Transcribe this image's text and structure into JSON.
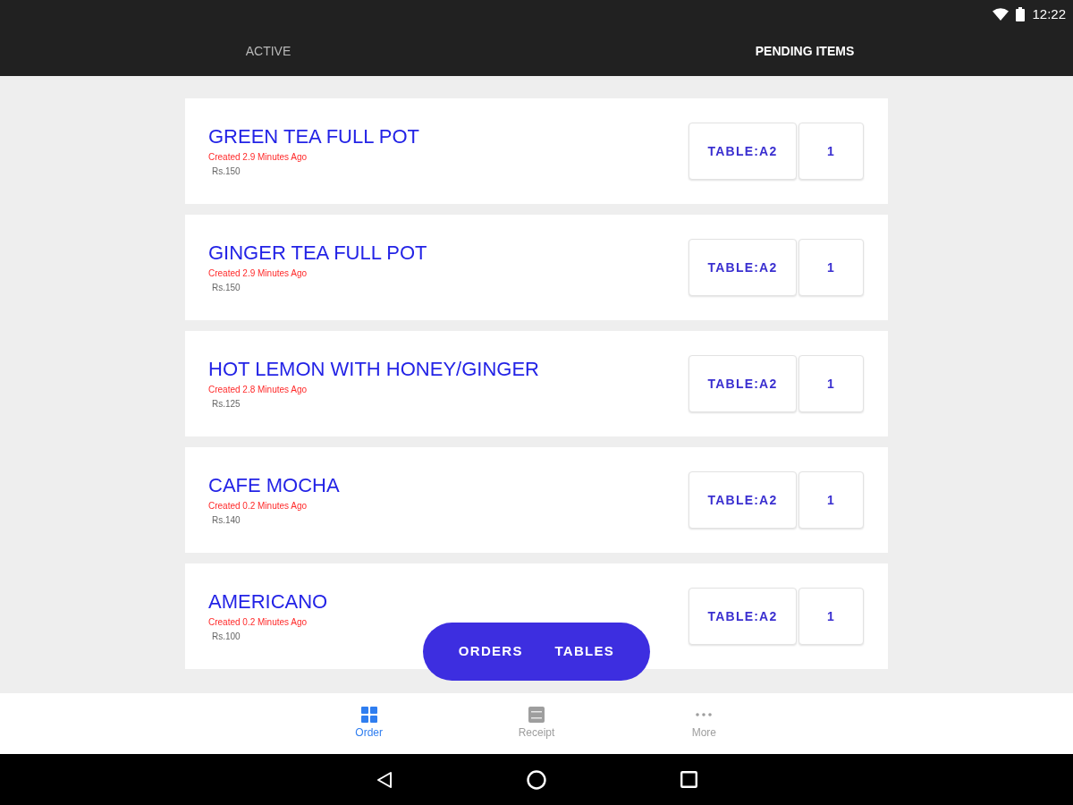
{
  "status_bar": {
    "time": "12:22"
  },
  "tabs": [
    {
      "label": "ACTIVE",
      "selected": false
    },
    {
      "label": "PENDING ITEMS",
      "selected": true
    }
  ],
  "orders": [
    {
      "name": "GREEN TEA FULL POT",
      "created": "Created 2.9 Minutes Ago",
      "price": "Rs.150",
      "table": "TABLE:A2",
      "quantity": "1"
    },
    {
      "name": "GINGER TEA FULL POT",
      "created": "Created 2.9 Minutes Ago",
      "price": "Rs.150",
      "table": "TABLE:A2",
      "quantity": "1"
    },
    {
      "name": "HOT LEMON WITH HONEY/GINGER",
      "created": "Created 2.8 Minutes Ago",
      "price": "Rs.125",
      "table": "TABLE:A2",
      "quantity": "1"
    },
    {
      "name": "CAFE MOCHA",
      "created": "Created 0.2 Minutes Ago",
      "price": "Rs.140",
      "table": "TABLE:A2",
      "quantity": "1"
    },
    {
      "name": "AMERICANO",
      "created": "Created 0.2 Minutes Ago",
      "price": "Rs.100",
      "table": "TABLE:A2",
      "quantity": "1"
    }
  ],
  "switcher": [
    {
      "label": "ORDERS"
    },
    {
      "label": "TABLES"
    }
  ],
  "bottom_nav": [
    {
      "label": "Order",
      "selected": true
    },
    {
      "label": "Receipt",
      "selected": false
    },
    {
      "label": "More",
      "selected": false
    }
  ]
}
